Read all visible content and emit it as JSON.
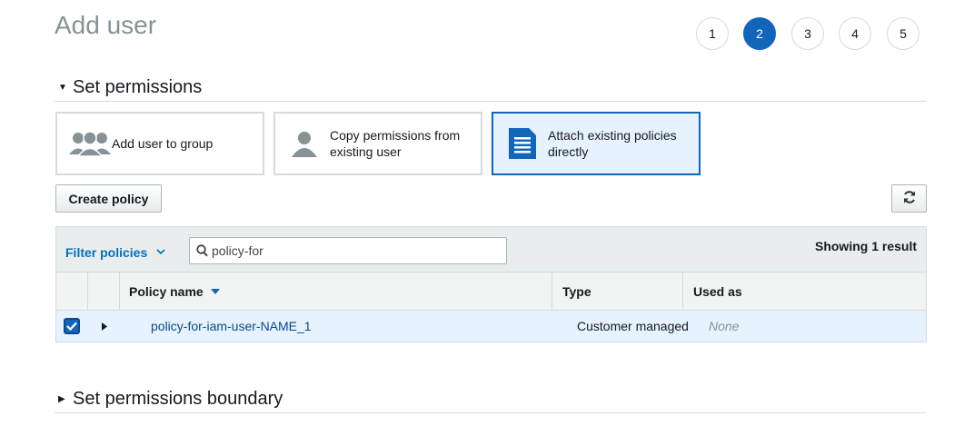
{
  "page": {
    "title": "Add user"
  },
  "wizard": {
    "steps": [
      "1",
      "2",
      "3",
      "4",
      "5"
    ],
    "active_step": "2"
  },
  "permissions": {
    "section_title": "Set permissions",
    "options": [
      {
        "label": "Add user to group",
        "icon": "group-icon"
      },
      {
        "label": "Copy permissions from existing user",
        "icon": "user-icon"
      },
      {
        "label": "Attach existing policies directly",
        "icon": "document-icon",
        "selected": true
      }
    ],
    "create_policy_label": "Create policy",
    "refresh_icon": "refresh-icon"
  },
  "policy_table": {
    "filter_label": "Filter policies",
    "search_value": "policy-for",
    "result_text": "Showing 1 result",
    "columns": [
      "Policy name",
      "Type",
      "Used as"
    ],
    "rows": [
      {
        "checked": true,
        "name": "policy-for-iam-user-NAME_1",
        "type": "Customer managed",
        "used_as": "None"
      }
    ]
  },
  "boundary": {
    "section_title": "Set permissions boundary"
  },
  "colors": {
    "accent": "#1166bb",
    "link": "#0073bb",
    "selected_bg": "#e6f2ff",
    "title_gray": "#879196"
  }
}
